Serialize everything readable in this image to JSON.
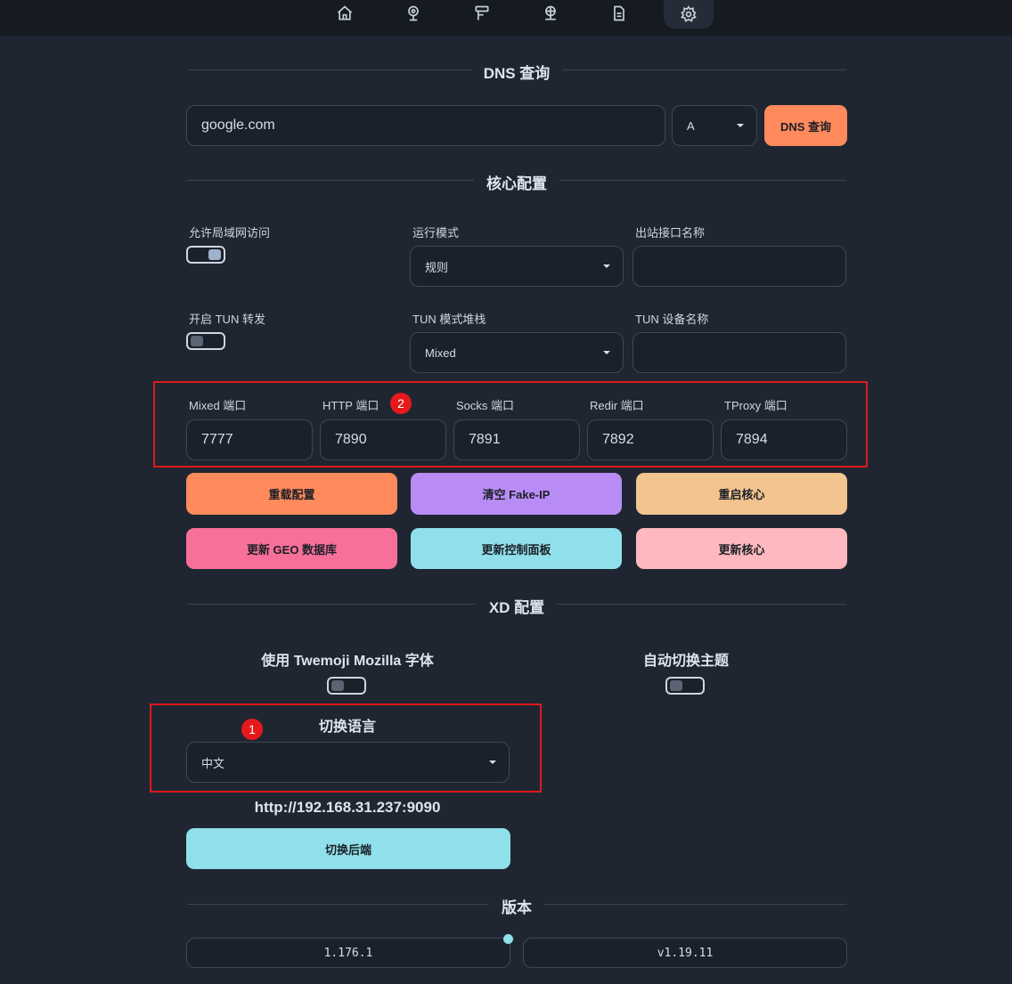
{
  "nav": {
    "icons": [
      "home-icon",
      "overview-icon",
      "proxies-icon",
      "connections-icon",
      "logs-icon",
      "settings-icon"
    ],
    "active": "settings-icon"
  },
  "dns": {
    "section_title": "DNS 查询",
    "domain_value": "google.com",
    "record_type": "A",
    "query_button": "DNS 查询"
  },
  "core": {
    "section_title": "核心配置",
    "allow_lan_label": "允许局域网访问",
    "allow_lan_on": true,
    "mode_label": "运行模式",
    "mode_value": "规则",
    "iface_label": "出站接口名称",
    "iface_value": "",
    "tun_label": "开启 TUN 转发",
    "tun_on": false,
    "tun_stack_label": "TUN 模式堆栈",
    "tun_stack_value": "Mixed",
    "tun_device_label": "TUN 设备名称",
    "tun_device_value": "",
    "ports": [
      {
        "label": "Mixed 端口",
        "value": "7777"
      },
      {
        "label": "HTTP 端口",
        "value": "7890"
      },
      {
        "label": "Socks 端口",
        "value": "7891"
      },
      {
        "label": "Redir 端口",
        "value": "7892"
      },
      {
        "label": "TProxy 端口",
        "value": "7894"
      }
    ],
    "annotation_ports": "2"
  },
  "actions": {
    "reload_config": "重载配置",
    "flush_fakeip": "清空 Fake-IP",
    "restart_core": "重启核心",
    "update_geo": "更新 GEO 数据库",
    "update_panel": "更新控制面板",
    "update_core": "更新核心"
  },
  "xd": {
    "section_title": "XD 配置",
    "twemoji_label": "使用 Twemoji Mozilla 字体",
    "twemoji_on": false,
    "auto_theme_label": "自动切换主题",
    "auto_theme_on": false,
    "language_label": "切换语言",
    "language_value": "中文",
    "annotation_language": "1",
    "backend_url": "http://192.168.31.237:9090",
    "switch_backend": "切换后端"
  },
  "version": {
    "section_title": "版本",
    "ui_version": "1.176.1",
    "core_version": "v1.19.11"
  },
  "colors": {
    "orange": "#ff8a5c",
    "purple": "#b98cf5",
    "peach": "#f2c48f",
    "pink": "#f7709a",
    "cyan": "#8fe0ea",
    "lightpink": "#ffb8bf",
    "annotation_red": "#e0191c"
  }
}
